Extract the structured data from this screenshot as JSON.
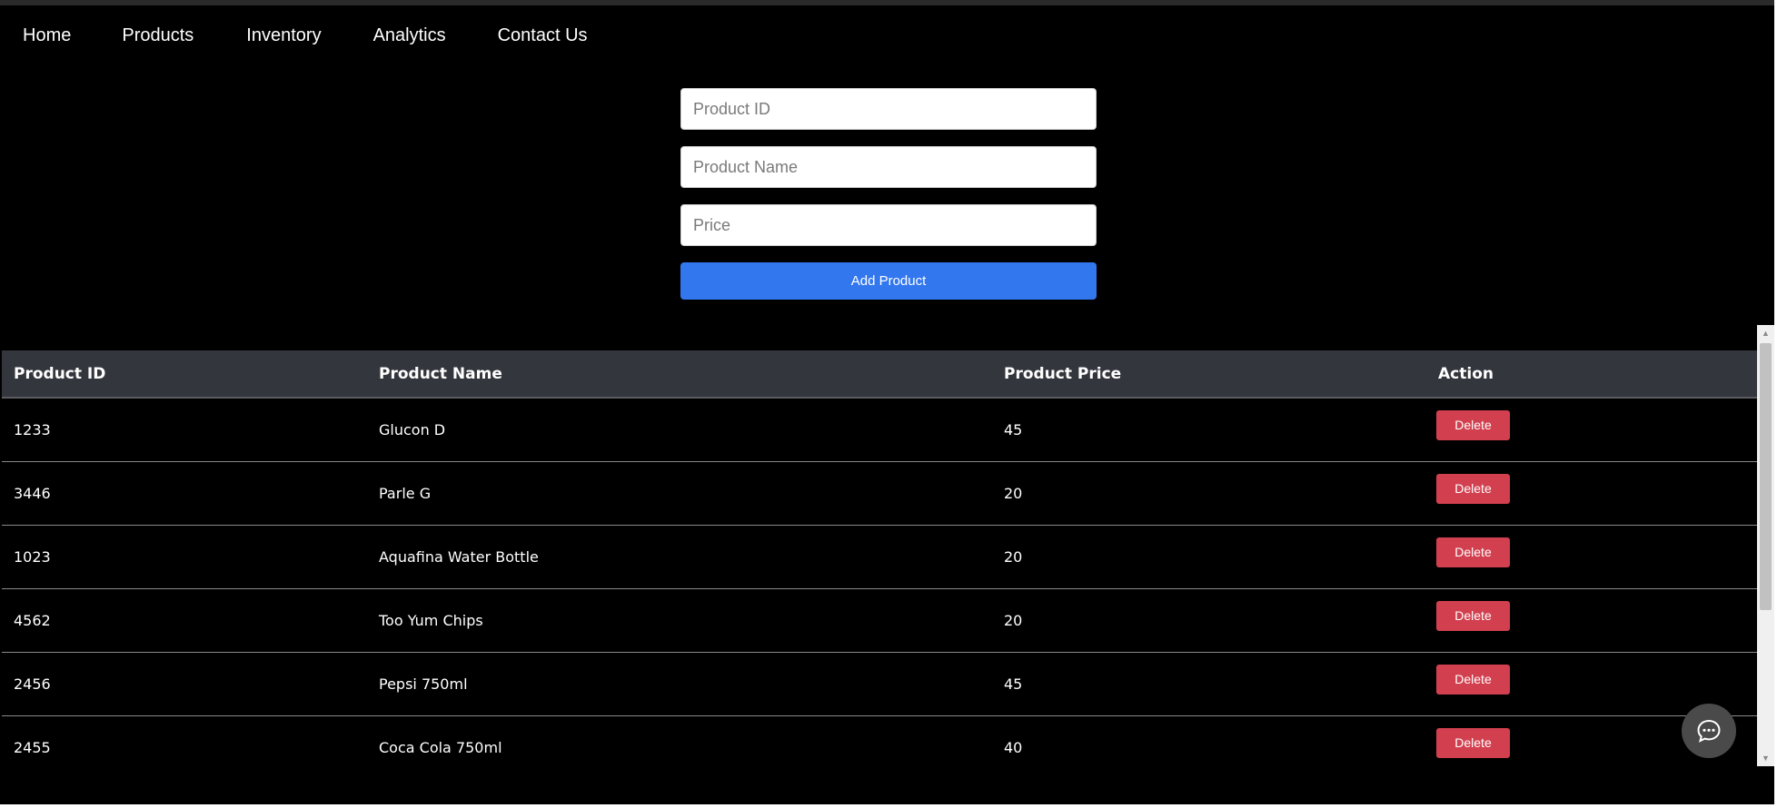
{
  "nav": {
    "items": [
      "Home",
      "Products",
      "Inventory",
      "Analytics",
      "Contact Us"
    ]
  },
  "form": {
    "product_id_placeholder": "Product ID",
    "product_name_placeholder": "Product Name",
    "price_placeholder": "Price",
    "add_button_label": "Add Product"
  },
  "table": {
    "headers": [
      "Product ID",
      "Product Name",
      "Product Price",
      "Action"
    ],
    "rows": [
      {
        "id": "1233",
        "name": "Glucon D",
        "price": "45",
        "action": "Delete"
      },
      {
        "id": "3446",
        "name": "Parle G",
        "price": "20",
        "action": "Delete"
      },
      {
        "id": "1023",
        "name": "Aquafina Water Bottle",
        "price": "20",
        "action": "Delete"
      },
      {
        "id": "4562",
        "name": "Too Yum Chips",
        "price": "20",
        "action": "Delete"
      },
      {
        "id": "2456",
        "name": "Pepsi 750ml",
        "price": "45",
        "action": "Delete"
      },
      {
        "id": "2455",
        "name": "Coca Cola 750ml",
        "price": "40",
        "action": "Delete"
      }
    ]
  },
  "chat": {
    "icon": "chat-bubble-icon"
  },
  "colors": {
    "background": "#000000",
    "add_button": "#3377ee",
    "delete_button": "#d2404f",
    "table_header": "#33363c"
  }
}
